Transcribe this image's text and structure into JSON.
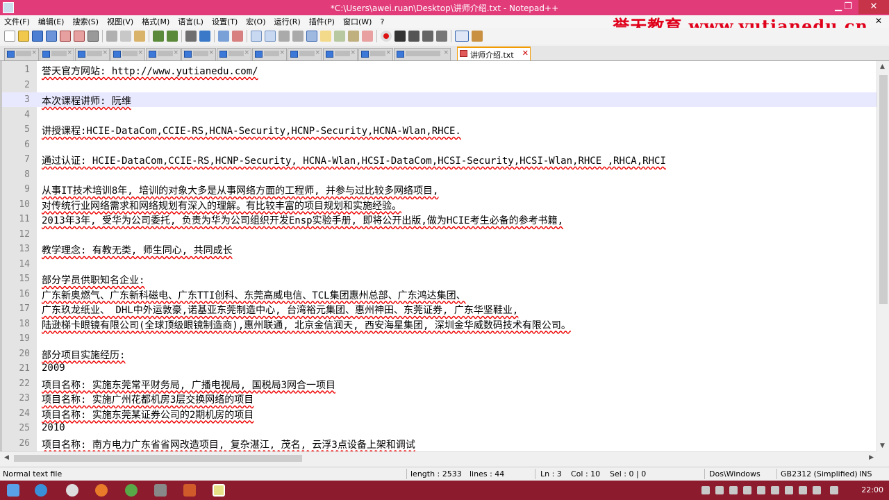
{
  "window": {
    "title": "*C:\\Users\\awei.ruan\\Desktop\\讲师介绍.txt - Notepad++",
    "minimize_glyph": "▁",
    "maximize_glyph": "❐",
    "close_glyph": "✕"
  },
  "brand_overlay": "誉天教育 www.yutianedu.cn",
  "menu": {
    "items": [
      "文件(F)",
      "编辑(E)",
      "搜索(S)",
      "视图(V)",
      "格式(M)",
      "语言(L)",
      "设置(T)",
      "宏(O)",
      "运行(R)",
      "插件(P)",
      "窗口(W)",
      "?"
    ],
    "close_glyph": "✕"
  },
  "tabs": {
    "active_label": "讲师介绍.txt",
    "close_glyph": "✕",
    "inactive_close_glyph": "×"
  },
  "editor": {
    "current_line": 3,
    "lines": [
      {
        "n": "1",
        "text": "誉天官方网站: http://www.yutianedu.com/"
      },
      {
        "n": "2",
        "text": ""
      },
      {
        "n": "3",
        "text": "本次课程讲师: 阮维"
      },
      {
        "n": "4",
        "text": ""
      },
      {
        "n": "5",
        "text": "讲授课程:HCIE-DataCom,CCIE-RS,HCNA-Security,HCNP-Security,HCNA-Wlan,RHCE."
      },
      {
        "n": "6",
        "text": ""
      },
      {
        "n": "7",
        "text": "通过认证: HCIE-DataCom,CCIE-RS,HCNP-Security, HCNA-Wlan,HCSI-DataCom,HCSI-Security,HCSI-Wlan,RHCE ,RHCA,RHCI"
      },
      {
        "n": "8",
        "text": ""
      },
      {
        "n": "9",
        "text": "从事IT技术培训8年, 培训的对象大多是从事网络方面的工程师, 并参与过比较多网络项目,"
      },
      {
        "n": "10",
        "text": "对传统行业网络需求和网络规划有深入的理解。有比较丰富的项目规划和实施经验。"
      },
      {
        "n": "11",
        "text": "2013年3年, 受华为公司委托, 负责为华为公司组织开发Ensp实验手册, 即将公开出版,做为HCIE考生必备的参考书籍,"
      },
      {
        "n": "12",
        "text": ""
      },
      {
        "n": "13",
        "text": "教学理念: 有教无类, 师生同心, 共同成长"
      },
      {
        "n": "14",
        "text": ""
      },
      {
        "n": "15",
        "text": "部分学员供职知名企业:"
      },
      {
        "n": "16",
        "text": "广东新奥燃气、广东新科磁电、广东TTI创科、东莞高威电信、TCL集团惠州总部、广东鸿达集团、"
      },
      {
        "n": "17",
        "text": "广东玖龙纸业、 DHL中外运敦豪,诺基亚东莞制造中心, 台湾裕元集团、惠州神田、东莞证券, 广东华坚鞋业,"
      },
      {
        "n": "18",
        "text": "陆逊梯卡眼镜有限公司(全球顶级眼镜制造商),惠州联通, 北京金信润天, 西安海星集团, 深圳金华威数码技术有限公司。"
      },
      {
        "n": "19",
        "text": ""
      },
      {
        "n": "20",
        "text": "部分项目实施经历:"
      },
      {
        "n": "21",
        "text": "2009"
      },
      {
        "n": "22",
        "text": "项目名称: 实施东莞常平财务局, 广播电视局, 国税局3网合一项目"
      },
      {
        "n": "23",
        "text": "项目名称: 实施广州花都机房3层交换网络的项目"
      },
      {
        "n": "24",
        "text": "项目名称: 实施东莞某证券公司的2期机房的项目"
      },
      {
        "n": "25",
        "text": "2010"
      },
      {
        "n": "26",
        "text": "项目名称: 南方电力广东省省网改造项目, 复杂湛江, 茂名, 云浮3点设备上架和调试"
      }
    ]
  },
  "statusbar": {
    "file_type": "Normal text file",
    "length": "length : 2533",
    "lines": "lines : 44",
    "ln": "Ln : 3",
    "col": "Col : 10",
    "sel": "Sel : 0 | 0",
    "eol": "Dos\\Windows",
    "encoding": "GB2312 (Simplified)",
    "mode": "INS"
  },
  "taskbar": {
    "clock": "22:00"
  },
  "colors": {
    "titlebar": "#e23b7a",
    "brand_red": "#e0001a",
    "taskbar": "#8b1b2d",
    "squiggle": "#e00000",
    "current_line": "#e8e8ff"
  }
}
